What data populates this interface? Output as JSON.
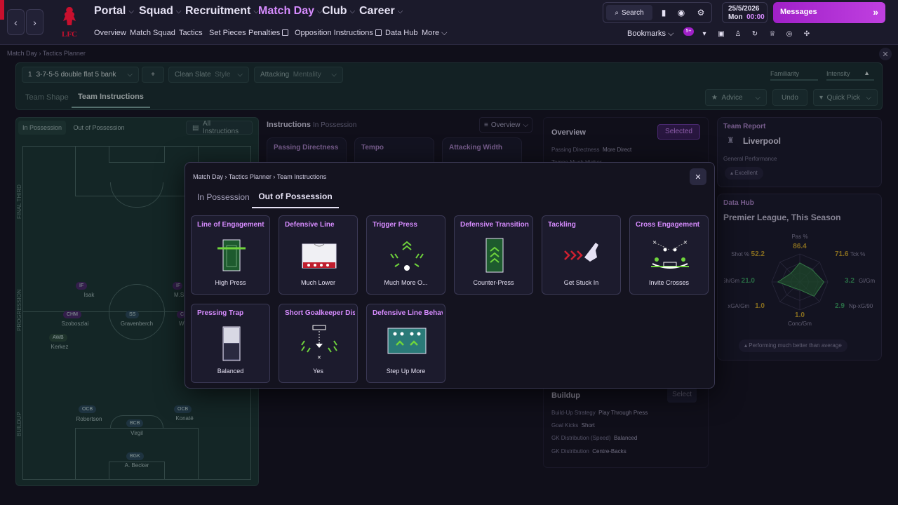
{
  "nav": {
    "back": "‹",
    "forward": "›",
    "main": [
      {
        "label": "Portal",
        "active": false
      },
      {
        "label": "Squad",
        "active": false
      },
      {
        "label": "Recruitment",
        "active": false
      },
      {
        "label": "Match Day",
        "active": true
      },
      {
        "label": "Club",
        "active": false
      },
      {
        "label": "Career",
        "active": false
      }
    ],
    "sub": [
      "Overview",
      "Match Squad",
      "Tactics",
      "Set Pieces",
      "Penalties",
      "Opposition Instructions",
      "Data Hub",
      "More"
    ],
    "search": "Search",
    "date": "25/5/2026",
    "day": "Mon",
    "time": "00:00",
    "messages": "Messages",
    "bookmarks": "Bookmarks",
    "badge": "5+"
  },
  "club": {
    "crest_text": "L.F.C."
  },
  "breadcrumb": {
    "a": "Match Day",
    "b": "Tactics Planner"
  },
  "planner": {
    "formation_num": "1",
    "formation": "3-7-5-5 double flat 5 bank",
    "add": "+",
    "style_value": "Clean Slate",
    "style_label": "Style",
    "mentality_value": "Attacking",
    "mentality_label": "Mentality",
    "familiarity": "Familiarity",
    "intensity": "Intensity",
    "tabs": [
      "Team Shape",
      "Team Instructions"
    ],
    "active_tab": "Team Instructions",
    "advice": "Advice",
    "undo": "Undo",
    "quick_pick": "Quick Pick"
  },
  "pitch": {
    "tab_in": "In Possession",
    "tab_out": "Out of Possession",
    "all": "All Instructions",
    "thirds": [
      "FINAL THIRD",
      "PROGRESSION",
      "BUILDUP"
    ],
    "players": [
      {
        "role": "IF",
        "name": "Isak"
      },
      {
        "role": "IF",
        "name": "M.S"
      },
      {
        "role": "CHM",
        "name": "Szoboszlai"
      },
      {
        "role": "SS",
        "name": "Gravenberch"
      },
      {
        "role": "C",
        "name": "W"
      },
      {
        "role": "AWB",
        "name": "Kerkez"
      },
      {
        "role": "OCB",
        "name": "Robertson"
      },
      {
        "role": "OCB",
        "name": "Konaté"
      },
      {
        "role": "BCB",
        "name": "Virgil"
      },
      {
        "role": "BGK",
        "name": "A. Becker"
      }
    ]
  },
  "instructions": {
    "title": "Instructions",
    "phase": "In Possession",
    "overview": "Overview",
    "cols": [
      "Passing Directness",
      "Tempo",
      "Attacking Width"
    ]
  },
  "overview": {
    "title": "Overview",
    "selected": "Selected",
    "line1_k": "Passing Directness",
    "line1_v": "More Direct",
    "line2": "Tempo  Much Higher",
    "buildup": "Buildup",
    "select": "Select",
    "rows": [
      {
        "k": "Build-Up Strategy",
        "v": "Play Through Press"
      },
      {
        "k": "Goal Kicks",
        "v": "Short"
      },
      {
        "k": "GK Distribution (Speed)",
        "v": "Balanced"
      },
      {
        "k": "GK Distribution",
        "v": "Centre-Backs"
      }
    ]
  },
  "team_report": {
    "title": "Team Report",
    "club": "Liverpool",
    "general": "General Performance",
    "rating": "Excellent"
  },
  "data_hub": {
    "title": "Data Hub",
    "subtitle": "Premier League, This Season",
    "footer": "Performing much better than average",
    "metrics": [
      {
        "label": "Pas %",
        "value": "86.4",
        "color": "#c9a227"
      },
      {
        "label": "Tck %",
        "value": "71.6",
        "color": "#c9a227"
      },
      {
        "label": "Gl/Gm",
        "value": "3.2",
        "color": "#3aa060"
      },
      {
        "label": "Np-xG/90",
        "value": "2.9",
        "color": "#3aa060"
      },
      {
        "label": "Conc/Gm",
        "value": "1.0",
        "color": "#c9a227"
      },
      {
        "label": "xGA/Gm",
        "value": "1.0",
        "color": "#c9a227"
      },
      {
        "label": "Sh/Gm",
        "value": "21.0",
        "color": "#3aa060"
      },
      {
        "label": "Shot %",
        "value": "52.2",
        "color": "#c9a227"
      }
    ],
    "radar_levels": [
      0.68,
      0.62,
      0.86,
      0.72,
      0.28,
      0.3,
      0.78,
      0.44
    ]
  },
  "modal": {
    "crumb": [
      "Match Day",
      "Tactics Planner",
      "Team Instructions"
    ],
    "tabs": [
      "In Possession",
      "Out of Possession"
    ],
    "active_tab": "Out of Possession",
    "close": "✕",
    "cards": [
      {
        "title": "Line of Engagement",
        "value": "High Press",
        "icon": "line-of-engagement-icon"
      },
      {
        "title": "Defensive Line",
        "value": "Much Lower",
        "icon": "defensive-line-icon"
      },
      {
        "title": "Trigger Press",
        "value": "Much More O...",
        "icon": "trigger-press-icon"
      },
      {
        "title": "Defensive Transition",
        "value": "Counter-Press",
        "icon": "defensive-transition-icon"
      },
      {
        "title": "Tackling",
        "value": "Get Stuck In",
        "icon": "tackling-icon"
      },
      {
        "title": "Cross Engagement",
        "value": "Invite Crosses",
        "icon": "cross-engagement-icon"
      },
      {
        "title": "Pressing Trap",
        "value": "Balanced",
        "icon": "pressing-trap-icon"
      },
      {
        "title": "Short Goalkeeper Distribution",
        "value": "Yes",
        "icon": "goalkeeper-distribution-icon"
      },
      {
        "title": "Defensive Line Behaviour",
        "value": "Step Up More",
        "icon": "defensive-line-behaviour-icon"
      }
    ]
  }
}
